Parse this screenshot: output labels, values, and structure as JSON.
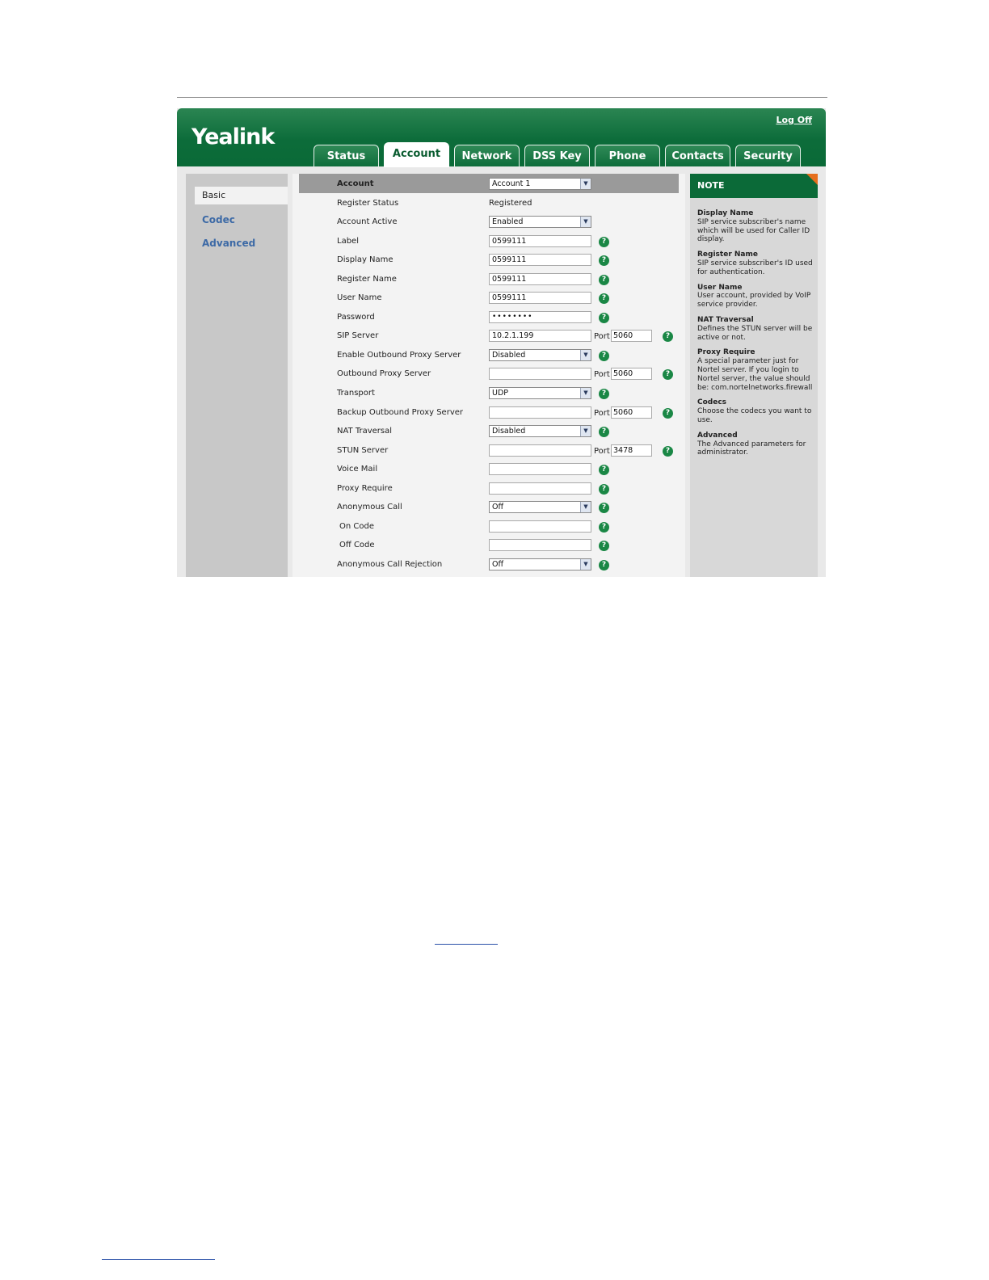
{
  "header": {
    "logo": "Yealink",
    "logoff": "Log Off",
    "tabs": [
      "Status",
      "Account",
      "Network",
      "DSS Key",
      "Phone",
      "Contacts",
      "Security"
    ],
    "active_tab": "Account"
  },
  "leftnav": {
    "items": [
      "Basic",
      "Codec",
      "Advanced"
    ],
    "selected": "Basic"
  },
  "form": {
    "account_label": "Account",
    "account_value": "Account 1",
    "rows": {
      "register_status": {
        "label": "Register Status",
        "value": "Registered"
      },
      "account_active": {
        "label": "Account Active",
        "value": "Enabled"
      },
      "label": {
        "label": "Label",
        "value": "0599111"
      },
      "display_name": {
        "label": "Display Name",
        "value": "0599111"
      },
      "register_name": {
        "label": "Register Name",
        "value": "0599111"
      },
      "user_name": {
        "label": "User Name",
        "value": "0599111"
      },
      "password": {
        "label": "Password",
        "value": "••••••••"
      },
      "sip_server": {
        "label": "SIP Server",
        "value": "10.2.1.199",
        "port": "5060"
      },
      "enable_outbound": {
        "label": "Enable Outbound Proxy Server",
        "value": "Disabled"
      },
      "outbound_server": {
        "label": "Outbound Proxy Server",
        "value": "",
        "port": "5060"
      },
      "transport": {
        "label": "Transport",
        "value": "UDP"
      },
      "backup_outbound": {
        "label": "Backup Outbound Proxy Server",
        "value": "",
        "port": "5060"
      },
      "nat_traversal": {
        "label": "NAT Traversal",
        "value": "Disabled"
      },
      "stun_server": {
        "label": "STUN Server",
        "value": "",
        "port": "3478"
      },
      "voice_mail": {
        "label": "Voice Mail",
        "value": ""
      },
      "proxy_require": {
        "label": "Proxy Require",
        "value": ""
      },
      "anonymous_call": {
        "label": "Anonymous Call",
        "value": "Off"
      },
      "on_code": {
        "label": "On Code",
        "value": ""
      },
      "off_code": {
        "label": "Off Code",
        "value": ""
      },
      "anonymous_rejection": {
        "label": "Anonymous Call Rejection",
        "value": "Off"
      }
    },
    "port_label": "Port",
    "help_glyph": "?"
  },
  "note": {
    "title": "NOTE",
    "entries": [
      {
        "title": "Display Name",
        "text": "SIP service subscriber's name which will be used for Caller ID display."
      },
      {
        "title": "Register Name",
        "text": "SIP service subscriber's ID used for authentication."
      },
      {
        "title": "User Name",
        "text": "User account, provided by VoIP service provider."
      },
      {
        "title": "NAT Traversal",
        "text": "Defines the STUN server will be active or not."
      },
      {
        "title": "Proxy Require",
        "text": "A special parameter just for Nortel server. If you login to Nortel server, the value should be: com.nortelnetworks.firewall"
      },
      {
        "title": "Codecs",
        "text": "Choose the codecs you want to use."
      },
      {
        "title": "Advanced",
        "text": "The Advanced parameters for administrator."
      }
    ]
  },
  "colors": {
    "header_green": "#0c6c3a",
    "link_blue": "#3d6aa6",
    "help_green": "#1a8745",
    "note_corner": "#e66f1d"
  }
}
